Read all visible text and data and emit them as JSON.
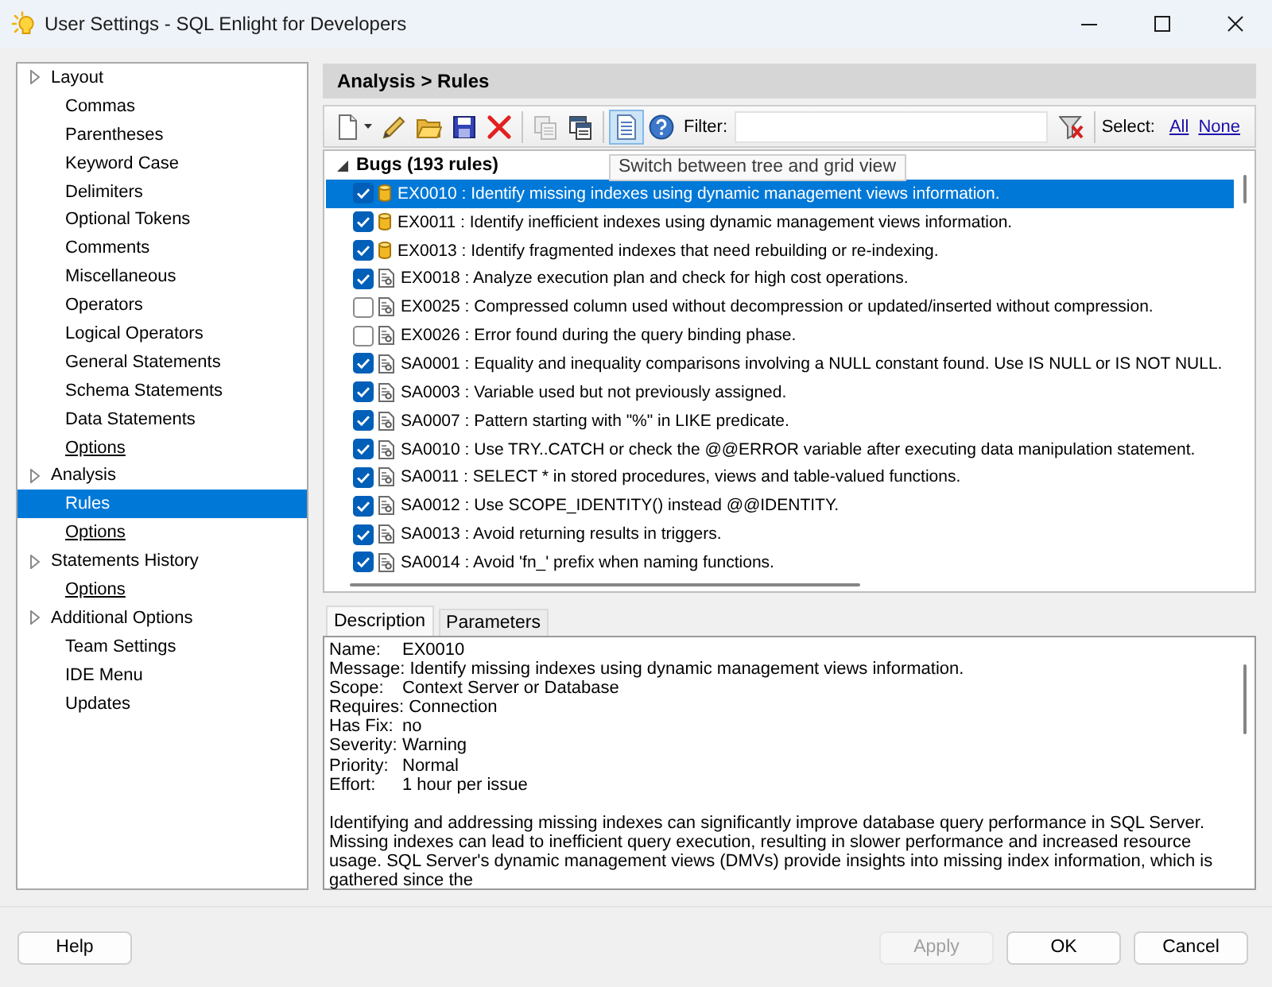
{
  "window": {
    "title": "User Settings - SQL Enlight for Developers"
  },
  "sidebar": {
    "items": [
      {
        "label": "Layout",
        "selected": false,
        "children": [
          {
            "label": "Commas",
            "kind": "page",
            "selected": false
          },
          {
            "label": "Parentheses",
            "kind": "page",
            "selected": false
          },
          {
            "label": "Keyword Case",
            "kind": "page",
            "selected": false
          },
          {
            "label": "Delimiters",
            "kind": "page",
            "selected": false
          },
          {
            "label": "Optional Tokens",
            "kind": "page",
            "selected": false
          },
          {
            "label": "Comments",
            "kind": "page",
            "selected": false
          },
          {
            "label": "Miscellaneous",
            "kind": "page",
            "selected": false
          },
          {
            "label": "Operators",
            "kind": "page",
            "selected": false
          },
          {
            "label": "Logical Operators",
            "kind": "page",
            "selected": false
          },
          {
            "label": "General Statements",
            "kind": "page",
            "selected": false
          },
          {
            "label": "Schema Statements",
            "kind": "page",
            "selected": false
          },
          {
            "label": "Data Statements",
            "kind": "page",
            "selected": false
          },
          {
            "label": "Options",
            "kind": "link",
            "selected": false
          }
        ]
      },
      {
        "label": "Analysis",
        "selected": false,
        "children": [
          {
            "label": "Rules",
            "kind": "page",
            "selected": true
          },
          {
            "label": "Options",
            "kind": "link",
            "selected": false
          }
        ]
      },
      {
        "label": "Statements History",
        "selected": false,
        "children": [
          {
            "label": "Options",
            "kind": "link",
            "selected": false
          }
        ]
      },
      {
        "label": "Additional Options",
        "selected": false,
        "children": [
          {
            "label": "Team Settings",
            "kind": "page",
            "selected": false
          },
          {
            "label": "IDE Menu",
            "kind": "page",
            "selected": false
          },
          {
            "label": "Updates",
            "kind": "page",
            "selected": false
          }
        ]
      }
    ]
  },
  "panel": {
    "breadcrumb": "Analysis > Rules"
  },
  "toolbar": {
    "groups": [
      [
        {
          "kind": "new",
          "disabled": false,
          "pressed": false
        },
        {
          "kind": "edit",
          "disabled": false,
          "pressed": false
        },
        {
          "kind": "open",
          "disabled": false,
          "pressed": false
        },
        {
          "kind": "save",
          "disabled": false,
          "pressed": false
        },
        {
          "kind": "delete",
          "disabled": false,
          "pressed": false
        }
      ],
      [
        {
          "kind": "copy",
          "disabled": true,
          "pressed": false
        },
        {
          "kind": "layout",
          "disabled": false,
          "pressed": false
        }
      ],
      [
        {
          "kind": "view",
          "disabled": false,
          "pressed": true
        },
        {
          "kind": "help",
          "disabled": false,
          "pressed": false
        }
      ]
    ],
    "filter": {
      "label": "Filter:"
    },
    "select": {
      "label": "Select:",
      "links": [
        "All",
        "None"
      ]
    },
    "tooltip": "Switch between tree and grid view"
  },
  "rule_groups": [
    {
      "label": "Bugs (193 rules)",
      "expanded": true,
      "rules": [
        {
          "text": "EX0010 : Identify missing indexes using dynamic management views information.",
          "kind": "database",
          "checked": true,
          "selected": true
        },
        {
          "text": "EX0011 : Identify inefficient indexes using dynamic management views information.",
          "kind": "database",
          "checked": true,
          "selected": false
        },
        {
          "text": "EX0013 : Identify fragmented indexes that need rebuilding or re-indexing.",
          "kind": "database",
          "checked": true,
          "selected": false
        },
        {
          "text": "EX0018 : Analyze execution plan and check for high cost operations.",
          "kind": "script",
          "checked": true,
          "selected": false
        },
        {
          "text": "EX0025 : Compressed column used without decompression or updated/inserted without compression.",
          "kind": "script",
          "checked": false,
          "selected": false
        },
        {
          "text": "EX0026 : Error found during the query binding phase.",
          "kind": "script",
          "checked": false,
          "selected": false
        },
        {
          "text": "SA0001 : Equality and inequality comparisons involving a NULL constant found. Use IS NULL or IS NOT NULL.",
          "kind": "script",
          "checked": true,
          "selected": false
        },
        {
          "text": "SA0003 : Variable used but not previously assigned.",
          "kind": "script",
          "checked": true,
          "selected": false
        },
        {
          "text": "SA0007 : Pattern starting with \"%\" in LIKE predicate.",
          "kind": "script",
          "checked": true,
          "selected": false
        },
        {
          "text": "SA0010 : Use TRY..CATCH or check the @@ERROR variable after executing data manipulation statement.",
          "kind": "script",
          "checked": true,
          "selected": false
        },
        {
          "text": "SA0011 : SELECT * in stored procedures, views and table-valued functions.",
          "kind": "script",
          "checked": true,
          "selected": false
        },
        {
          "text": "SA0012 : Use SCOPE_IDENTITY() instead @@IDENTITY.",
          "kind": "script",
          "checked": true,
          "selected": false
        },
        {
          "text": "SA0013 : Avoid returning results in triggers.",
          "kind": "script",
          "checked": true,
          "selected": false
        },
        {
          "text": "SA0014 : Avoid 'fn_' prefix when naming functions.",
          "kind": "script",
          "checked": true,
          "selected": false
        }
      ]
    }
  ],
  "details": {
    "tabs": [
      {
        "label": "Description",
        "selected": true
      },
      {
        "label": "Parameters",
        "selected": false
      }
    ],
    "fields": [
      {
        "label": "Name:",
        "value": "EX0010"
      },
      {
        "label": "Message:",
        "value": "Identify missing indexes using dynamic management views information."
      },
      {
        "label": "Scope:",
        "value": "Context Server or Database"
      },
      {
        "label": "Requires:",
        "value": "Connection"
      },
      {
        "label": "Has Fix:",
        "value": "no"
      },
      {
        "label": "Severity:",
        "value": "Warning"
      },
      {
        "label": "Priority:",
        "value": "Normal"
      },
      {
        "label": "Effort:",
        "value": "1 hour per issue"
      }
    ],
    "paragraphs": [
      "Identifying and addressing missing indexes can significantly improve database query performance in SQL Server.",
      "Missing indexes can lead to inefficient query execution, resulting in slower performance and increased resource usage. SQL Server's dynamic management views (DMVs) provide insights into missing index information, which is gathered since the"
    ]
  },
  "footer": {
    "left_buttons": [
      {
        "label": "Help",
        "disabled": false
      }
    ],
    "right_buttons": [
      {
        "label": "Apply",
        "disabled": true
      },
      {
        "label": "OK",
        "disabled": false
      },
      {
        "label": "Cancel",
        "disabled": false
      }
    ]
  }
}
